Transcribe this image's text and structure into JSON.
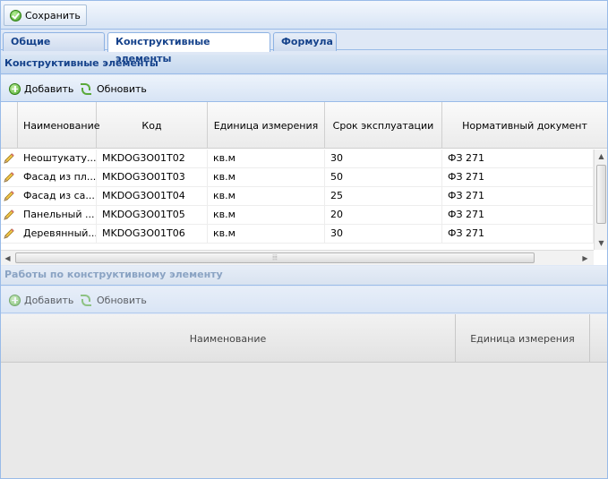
{
  "toolbar": {
    "save_label": "Сохранить"
  },
  "tabs": [
    {
      "label": "Общие сведения",
      "active": false
    },
    {
      "label": "Конструктивные элементы",
      "active": true
    },
    {
      "label": "Формула",
      "active": false
    }
  ],
  "elements_panel": {
    "title": "Конструктивные элементы",
    "add_label": "Добавить",
    "refresh_label": "Обновить",
    "columns": [
      "Наименование",
      "Код",
      "Единица измерения",
      "Срок эксплуатации",
      "Нормативный документ"
    ],
    "rows": [
      {
        "name": "Неоштукату...",
        "code": "MKDOG3O01T02",
        "unit": "кв.м",
        "lifetime": "30",
        "doc": "ФЗ 271"
      },
      {
        "name": "Фасад из пл...",
        "code": "MKDOG3O01T03",
        "unit": "кв.м",
        "lifetime": "50",
        "doc": "ФЗ 271"
      },
      {
        "name": "Фасад из са...",
        "code": "MKDOG3O01T04",
        "unit": "кв.м",
        "lifetime": "25",
        "doc": "ФЗ 271"
      },
      {
        "name": "Панельный ...",
        "code": "MKDOG3O01T05",
        "unit": "кв.м",
        "lifetime": "20",
        "doc": "ФЗ 271"
      },
      {
        "name": "Деревянный...",
        "code": "MKDOG3O01T06",
        "unit": "кв.м",
        "lifetime": "30",
        "doc": "ФЗ 271"
      }
    ]
  },
  "works_panel": {
    "title": "Работы по конструктивному элементу",
    "add_label": "Добавить",
    "refresh_label": "Обновить",
    "columns": [
      "Наименование",
      "Единица измерения"
    ]
  },
  "colors": {
    "header_text": "#15428b",
    "border": "#99bbe8"
  },
  "icons": {
    "save": "check-circle-icon",
    "add": "plus-circle-icon",
    "refresh": "refresh-icon",
    "edit": "pencil-icon"
  }
}
